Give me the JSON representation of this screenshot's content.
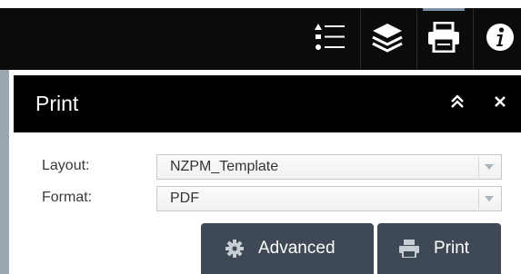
{
  "toolbar": {
    "icons": [
      "legend-icon",
      "layers-icon",
      "print-icon",
      "info-icon"
    ],
    "active": "print-icon"
  },
  "panel": {
    "title": "Print",
    "collapse_icon": "double-chevron-up-icon",
    "close_icon": "close-icon"
  },
  "form": {
    "layout_label": "Layout:",
    "layout_value": "NZPM_Template",
    "format_label": "Format:",
    "format_value": "PDF"
  },
  "buttons": {
    "advanced_label": "Advanced",
    "print_label": "Print"
  },
  "colors": {
    "toolbar_bg": "#0b0b0b",
    "panel_header_bg": "#000000",
    "button_bg": "#3e4955",
    "active_indicator": "#7b8da1"
  }
}
